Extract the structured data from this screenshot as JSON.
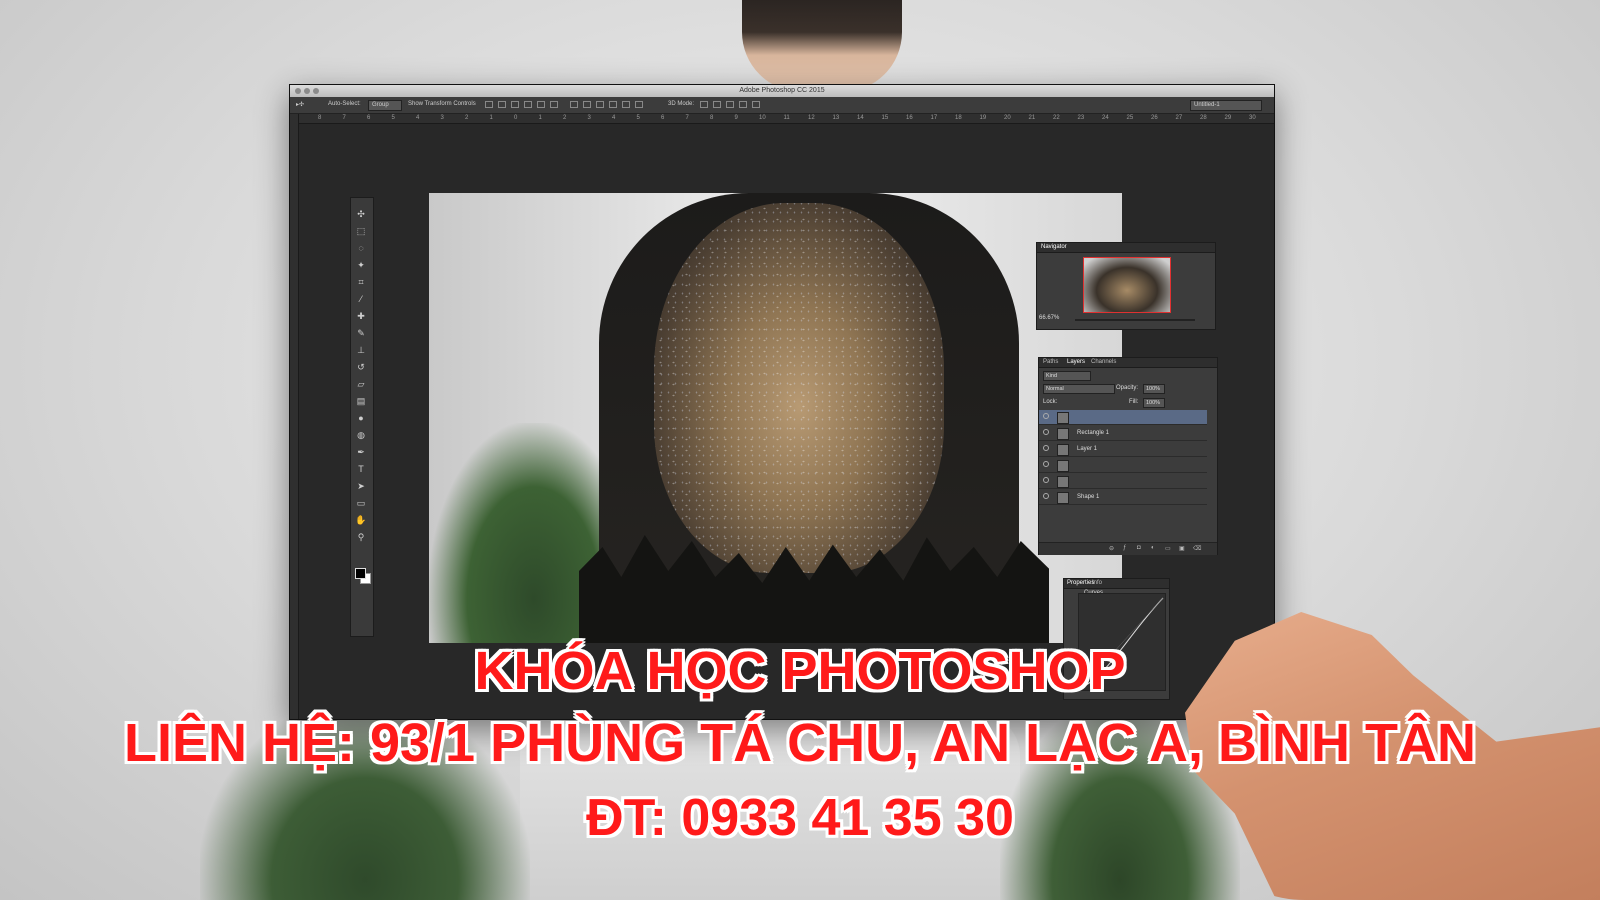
{
  "window": {
    "title": "Adobe Photoshop CC 2015"
  },
  "options_bar": {
    "auto_select_label": "Auto-Select:",
    "auto_select_value": "Group",
    "transform_label": "Show Transform Controls",
    "mode_3d_label": "3D Mode:",
    "document_value": "Untitled-1"
  },
  "ruler": {
    "h_ticks": [
      "8",
      "7",
      "6",
      "5",
      "4",
      "3",
      "2",
      "1",
      "0",
      "1",
      "2",
      "3",
      "4",
      "5",
      "6",
      "7",
      "8",
      "9",
      "10",
      "11",
      "12",
      "13",
      "14",
      "15",
      "16",
      "17",
      "18",
      "19",
      "20",
      "21",
      "22",
      "23",
      "24",
      "25",
      "26",
      "27",
      "28",
      "29",
      "30"
    ]
  },
  "tools": [
    "move-tool-icon",
    "marquee-tool-icon",
    "lasso-tool-icon",
    "magic-wand-icon",
    "crop-tool-icon",
    "eyedropper-icon",
    "healing-brush-icon",
    "brush-tool-icon",
    "clone-stamp-icon",
    "history-brush-icon",
    "eraser-icon",
    "gradient-tool-icon",
    "blur-tool-icon",
    "dodge-tool-icon",
    "pen-tool-icon",
    "type-tool-icon",
    "path-select-icon",
    "shape-tool-icon",
    "hand-tool-icon",
    "zoom-tool-icon"
  ],
  "navigator": {
    "tab": "Navigator",
    "zoom": "66.67%"
  },
  "layers_panel": {
    "tabs": [
      "Paths",
      "Layers",
      "Channels"
    ],
    "kind_label": "Kind",
    "blend_mode": "Normal",
    "opacity_label": "Opacity:",
    "opacity_value": "100%",
    "lock_label": "Lock:",
    "fill_label": "Fill:",
    "fill_value": "100%",
    "layers": [
      {
        "name": "",
        "selected": true
      },
      {
        "name": "Rectangle 1",
        "selected": false
      },
      {
        "name": "Layer 1",
        "selected": false
      },
      {
        "name": "",
        "selected": false
      },
      {
        "name": "",
        "selected": false
      },
      {
        "name": "Shape 1",
        "selected": false
      }
    ]
  },
  "properties_panel": {
    "tabs": [
      "Properties",
      "Info"
    ],
    "adjustment": "Curves"
  },
  "promo": {
    "line1": "KHÓA HỌC PHOTOSHOP",
    "line2": "LIÊN HỆ: 93/1 PHÙNG TÁ CHU, AN LẠC A, BÌNH TÂN",
    "line3": "ĐT: 0933 41 35 30"
  },
  "colors": {
    "promo_text": "#ff1a1a",
    "promo_outline": "#ffffff",
    "app_background": "#282828",
    "navigator_frame": "#e03131"
  }
}
